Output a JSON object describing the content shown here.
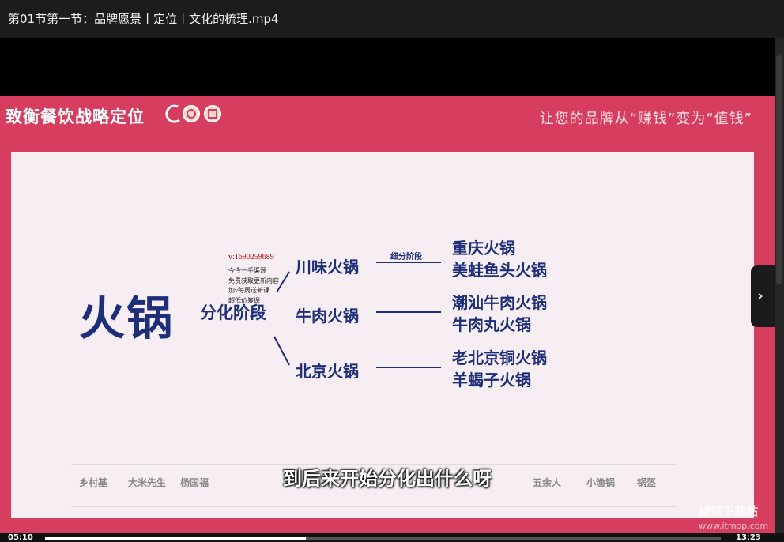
{
  "window": {
    "title": "第01节第一节：品牌愿景丨定位丨文化的梳理.mp4"
  },
  "slide": {
    "brand": "致衡餐饮战略定位",
    "slogan": "让您的品牌从“赚钱”变为“值钱”",
    "diagram": {
      "root": "火锅",
      "stage": "分化阶段",
      "sub_label": "细分阶段",
      "branches": [
        {
          "label": "川味火锅",
          "leaves": [
            "重庆火锅",
            "美蛙鱼头火锅"
          ]
        },
        {
          "label": "牛肉火锅",
          "leaves": [
            "潮汕牛肉火锅",
            "牛肉丸火锅"
          ]
        },
        {
          "label": "北京火锅",
          "leaves": [
            "老北京铜火锅",
            "羊蝎子火锅"
          ]
        }
      ]
    },
    "overlay_contact": "v:1690259689",
    "overlay_lines": [
      "今今一手渠源",
      "免费获取更新内容",
      "加v每周送新课",
      "超低价筹课"
    ],
    "logos": [
      "乡村基",
      "大米先生",
      "杨国福",
      "",
      "",
      "",
      "",
      "",
      "五余人",
      "",
      "小渔锅",
      "锅盔"
    ]
  },
  "subtitle": "到后来开始分化出什么呀",
  "site_watermark": {
    "name": "绿软下载站",
    "url": "www.itmop.com"
  },
  "player": {
    "current_time": "05:10",
    "total_time": "13:23",
    "progress_fraction": 0.386,
    "next_icon": "chevron-right-icon"
  },
  "colors": {
    "slide_red": "#d73d5e",
    "diagram_navy": "#1e2f7a"
  }
}
